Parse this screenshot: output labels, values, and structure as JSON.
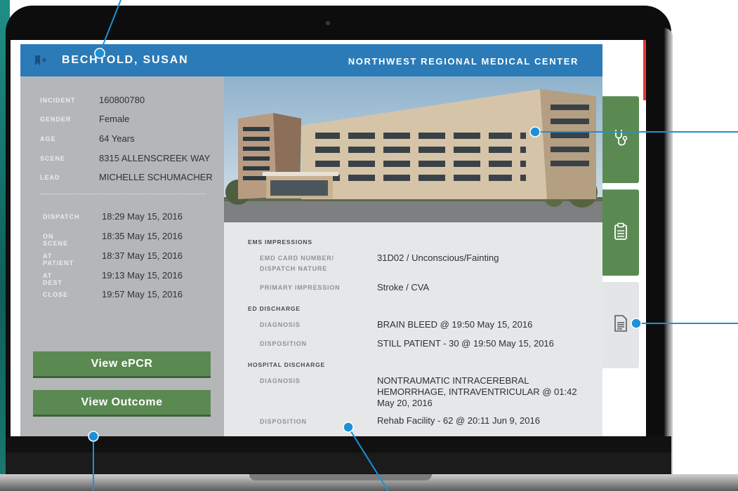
{
  "header": {
    "patient_name": "BECHTOLD, SUSAN",
    "facility": "NORTHWEST REGIONAL MEDICAL CENTER"
  },
  "patient": {
    "fields": [
      {
        "label": "INCIDENT",
        "value": "160800780"
      },
      {
        "label": "GENDER",
        "value": "Female"
      },
      {
        "label": "AGE",
        "value": "64 Years"
      },
      {
        "label": "SCENE",
        "value": "8315 ALLENSCREEK WAY"
      },
      {
        "label": "LEAD",
        "value": "MICHELLE SCHUMACHER"
      }
    ],
    "times": [
      {
        "label": "DISPATCH",
        "value": "18:29 May 15, 2016"
      },
      {
        "label": "ON SCENE",
        "value": "18:35 May 15, 2016"
      },
      {
        "label": "AT PATIENT",
        "value": "18:37 May 15, 2016"
      },
      {
        "label": "AT DEST",
        "value": "19:13 May 15, 2016"
      },
      {
        "label": "CLOSE",
        "value": "19:57 May 15, 2016"
      }
    ]
  },
  "buttons": {
    "view_epcr": "View ePCR",
    "view_outcome": "View Outcome"
  },
  "details": {
    "ems_title": "EMS IMPRESSIONS",
    "emd_label_1": "EMD CARD NUMBER/",
    "emd_label_2": "DISPATCH NATURE",
    "emd_value": "31D02 / Unconscious/Fainting",
    "primary_label": "PRIMARY IMPRESSION",
    "primary_value": "Stroke / CVA",
    "ed_title": "ED DISCHARGE",
    "ed_diagnosis_label": "DIAGNOSIS",
    "ed_diagnosis_value": "BRAIN BLEED @ 19:50 May 15, 2016",
    "ed_disposition_label": "DISPOSITION",
    "ed_disposition_value": "STILL PATIENT - 30 @ 19:50 May 15, 2016",
    "hosp_title": "HOSPITAL DISCHARGE",
    "hosp_diagnosis_label": "DIAGNOSIS",
    "hosp_diagnosis_1": "NONTRAUMATIC INTRACEREBRAL",
    "hosp_diagnosis_2": "HEMORRHAGE, INTRAVENTRICULAR @ 01:42",
    "hosp_diagnosis_3": "May 20, 2016",
    "hosp_disposition_label": "DISPOSITION",
    "hosp_disposition_value": "Rehab Facility - 62 @ 20:11 Jun 9, 2016"
  },
  "tabs": [
    {
      "icon": "stethoscope-icon",
      "state": "inactive"
    },
    {
      "icon": "clipboard-icon",
      "state": "inactive"
    },
    {
      "icon": "document-icon",
      "state": "active"
    }
  ],
  "colors": {
    "header": "#2a7bb8",
    "button": "#5a8a52",
    "sidebar": "#b4b6b8",
    "callout": "#1e90d6"
  }
}
